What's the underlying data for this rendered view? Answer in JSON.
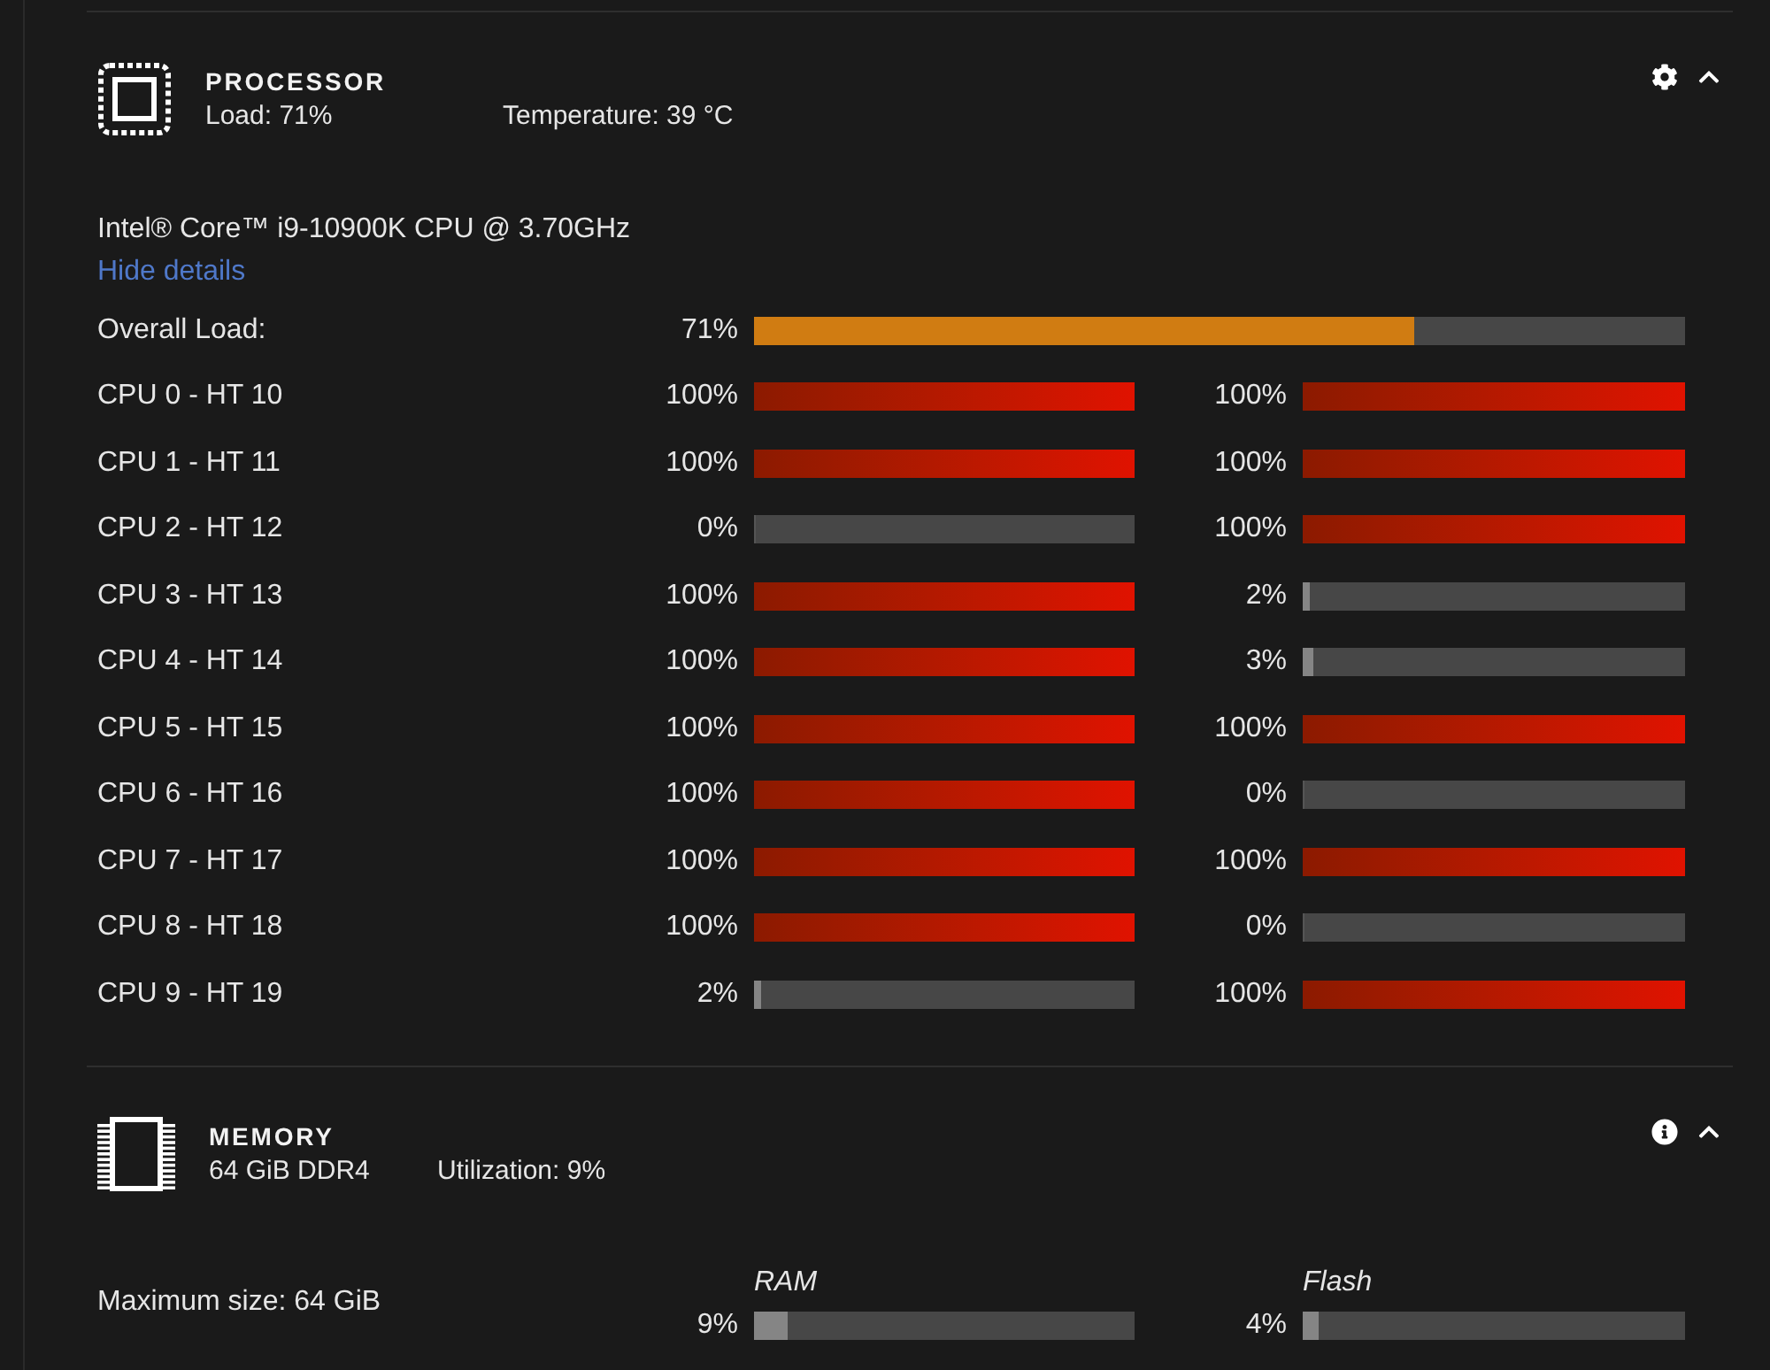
{
  "processor": {
    "title": "PROCESSOR",
    "expanded": true,
    "load": "Load: 71%",
    "temperature": "Temperature: 39 °C",
    "model": "Intel® Core™ i9-10900K CPU @ 3.70GHz",
    "details_link": "Hide details",
    "overall": {
      "label": "Overall Load:",
      "reading": "71%",
      "level": 0.71
    },
    "cores": [
      {
        "label": "CPU 0 - HT 10",
        "threads": [
          {
            "reading": "100%",
            "level": 1
          },
          {
            "reading": "100%",
            "level": 1
          }
        ]
      },
      {
        "label": "CPU 1 - HT 11",
        "threads": [
          {
            "reading": "100%",
            "level": 1
          },
          {
            "reading": "100%",
            "level": 1
          }
        ]
      },
      {
        "label": "CPU 2 - HT 12",
        "threads": [
          {
            "reading": "0%",
            "level": 0
          },
          {
            "reading": "100%",
            "level": 1
          }
        ]
      },
      {
        "label": "CPU 3 - HT 13",
        "threads": [
          {
            "reading": "100%",
            "level": 1
          },
          {
            "reading": "2%",
            "level": 0.02
          }
        ]
      },
      {
        "label": "CPU 4 - HT 14",
        "threads": [
          {
            "reading": "100%",
            "level": 1
          },
          {
            "reading": "3%",
            "level": 0.03
          }
        ]
      },
      {
        "label": "CPU 5 - HT 15",
        "threads": [
          {
            "reading": "100%",
            "level": 1
          },
          {
            "reading": "100%",
            "level": 1
          }
        ]
      },
      {
        "label": "CPU 6 - HT 16",
        "threads": [
          {
            "reading": "100%",
            "level": 1
          },
          {
            "reading": "0%",
            "level": 0
          }
        ]
      },
      {
        "label": "CPU 7 - HT 17",
        "threads": [
          {
            "reading": "100%",
            "level": 1
          },
          {
            "reading": "100%",
            "level": 1
          }
        ]
      },
      {
        "label": "CPU 8 - HT 18",
        "threads": [
          {
            "reading": "100%",
            "level": 1
          },
          {
            "reading": "0%",
            "level": 0
          }
        ]
      },
      {
        "label": "CPU 9 - HT 19",
        "threads": [
          {
            "reading": "2%",
            "level": 0.02
          },
          {
            "reading": "100%",
            "level": 1
          }
        ]
      }
    ]
  },
  "memory": {
    "title": "MEMORY",
    "expanded": true,
    "size": "64 GiB DDR4",
    "utilization": "Utilization: 9%",
    "max_size": "Maximum size: 64 GiB",
    "meters": [
      {
        "label": "RAM",
        "reading": "9%",
        "level": 0.09
      },
      {
        "label": "Flash",
        "reading": "4%",
        "level": 0.04
      }
    ]
  }
}
